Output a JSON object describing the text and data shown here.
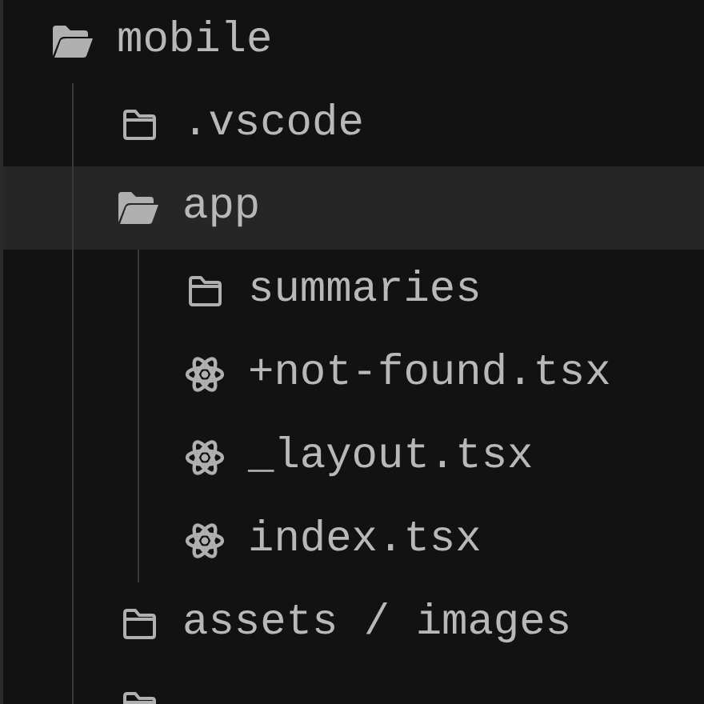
{
  "tree": [
    {
      "label": "mobile",
      "kind": "folder",
      "expanded": true,
      "selected": false,
      "children": [
        {
          "label": ".vscode",
          "kind": "folder",
          "expanded": false,
          "selected": false
        },
        {
          "label": "app",
          "kind": "folder",
          "expanded": true,
          "selected": true,
          "children": [
            {
              "label": "summaries",
              "kind": "folder",
              "expanded": false,
              "selected": false
            },
            {
              "label": "+not-found.tsx",
              "kind": "react",
              "selected": false
            },
            {
              "label": "_layout.tsx",
              "kind": "react",
              "selected": false
            },
            {
              "label": "index.tsx",
              "kind": "react",
              "selected": false
            }
          ]
        },
        {
          "label": "assets / images",
          "kind": "folder",
          "expanded": false,
          "selected": false
        },
        {
          "kind": "folder",
          "expanded": false,
          "selected": false
        }
      ]
    }
  ]
}
